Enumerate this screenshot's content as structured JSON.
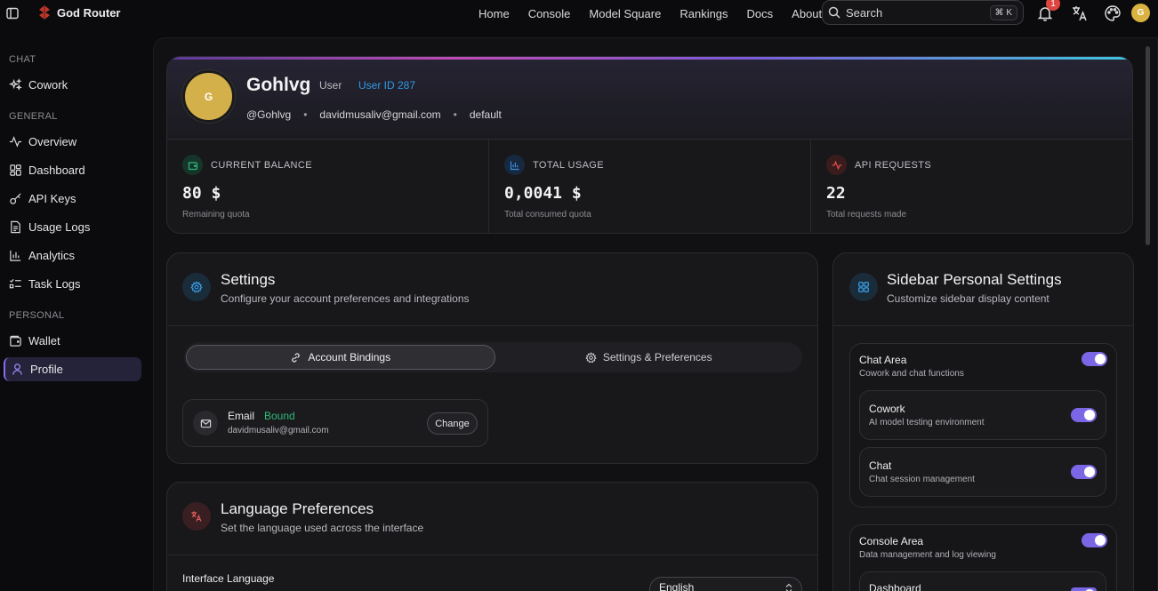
{
  "brand": {
    "name": "God Router"
  },
  "topnav": [
    "Home",
    "Console",
    "Model Square",
    "Rankings",
    "Docs",
    "About"
  ],
  "search": {
    "placeholder": "Search",
    "shortcut": "⌘ K"
  },
  "notifications": {
    "count": "1"
  },
  "user_avatar_letter": "G",
  "sidebar": {
    "sections": {
      "chat": "CHAT",
      "general": "GENERAL",
      "personal": "PERSONAL"
    },
    "items": {
      "cowork": "Cowork",
      "overview": "Overview",
      "dashboard": "Dashboard",
      "api_keys": "API Keys",
      "usage_logs": "Usage Logs",
      "analytics": "Analytics",
      "task_logs": "Task Logs",
      "wallet": "Wallet",
      "profile": "Profile"
    },
    "active": "profile"
  },
  "profile": {
    "avatar_letter": "G",
    "name": "Gohlvg",
    "role": "User",
    "user_id": "User ID 287",
    "handle": "@Gohlvg",
    "email": "davidmusaliv@gmail.com",
    "group": "default"
  },
  "stats": [
    {
      "label": "CURRENT BALANCE",
      "value": "80 $",
      "sub": "Remaining quota",
      "color": "#2fb87a",
      "icon": "wallet-icon"
    },
    {
      "label": "TOTAL USAGE",
      "value": "0,0041 $",
      "sub": "Total consumed quota",
      "color": "#3b8ee8",
      "icon": "bar-chart-icon"
    },
    {
      "label": "API REQUESTS",
      "value": "22",
      "sub": "Total requests made",
      "color": "#e0504a",
      "icon": "activity-icon"
    }
  ],
  "settings": {
    "title": "Settings",
    "subtitle": "Configure your account preferences and integrations",
    "tabs": [
      "Account Bindings",
      "Settings & Preferences"
    ],
    "active_tab": "Account Bindings",
    "email_binding": {
      "label": "Email",
      "status": "Bound",
      "address": "davidmusaliv@gmail.com",
      "button": "Change"
    }
  },
  "language": {
    "title": "Language Preferences",
    "subtitle": "Set the language used across the interface",
    "field_label": "Interface Language",
    "selected": "English"
  },
  "sidebar_settings": {
    "title": "Sidebar Personal Settings",
    "subtitle": "Customize sidebar display content",
    "groups": [
      {
        "title": "Chat Area",
        "subtitle": "Cowork and chat functions",
        "enabled": true,
        "items": [
          {
            "title": "Cowork",
            "subtitle": "AI model testing environment",
            "enabled": true
          },
          {
            "title": "Chat",
            "subtitle": "Chat session management",
            "enabled": true
          }
        ]
      },
      {
        "title": "Console Area",
        "subtitle": "Data management and log viewing",
        "enabled": true,
        "items": [
          {
            "title": "Dashboard",
            "subtitle": "",
            "enabled": true
          }
        ]
      }
    ]
  },
  "colors": {
    "accent": "#7b67e6",
    "success": "#2fb87a",
    "link": "#2f9be8",
    "avatar": "#d4b04a"
  }
}
